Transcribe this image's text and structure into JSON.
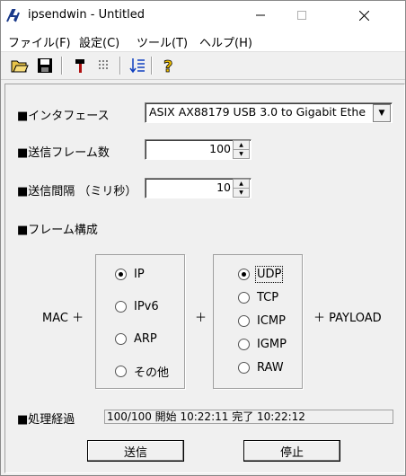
{
  "window": {
    "title": "ipsendwin - Untitled"
  },
  "menu": [
    "ファイル(F)",
    "設定(C)",
    "ツール(T)",
    "ヘルプ(H)"
  ],
  "toolbar": [
    "open-folder-icon",
    "save-icon",
    "hammer-icon",
    "grid-icon",
    "sort-icon",
    "help-icon"
  ],
  "form": {
    "interface_label": "■インタフェース",
    "interface_value": "ASIX AX88179 USB 3.0 to Gigabit Ethe",
    "frame_count_label": "■送信フレーム数",
    "frame_count_value": "100",
    "interval_label": "■送信間隔 （ミリ秒）",
    "interval_value": "10",
    "frame_config_label": "■フレーム構成",
    "mac_label": "MAC ＋",
    "plus_label": "＋",
    "payload_label": "＋ PAYLOAD",
    "l3_options": [
      "IP",
      "IPv6",
      "ARP",
      "その他"
    ],
    "l3_selected": "IP",
    "l4_options": [
      "UDP",
      "TCP",
      "ICMP",
      "IGMP",
      "RAW"
    ],
    "l4_selected": "UDP",
    "progress_label": "■処理経過",
    "progress_text": "100/100 開始 10:22:11 完了 10:22:12"
  },
  "buttons": {
    "send": "送信",
    "stop": "停止"
  }
}
